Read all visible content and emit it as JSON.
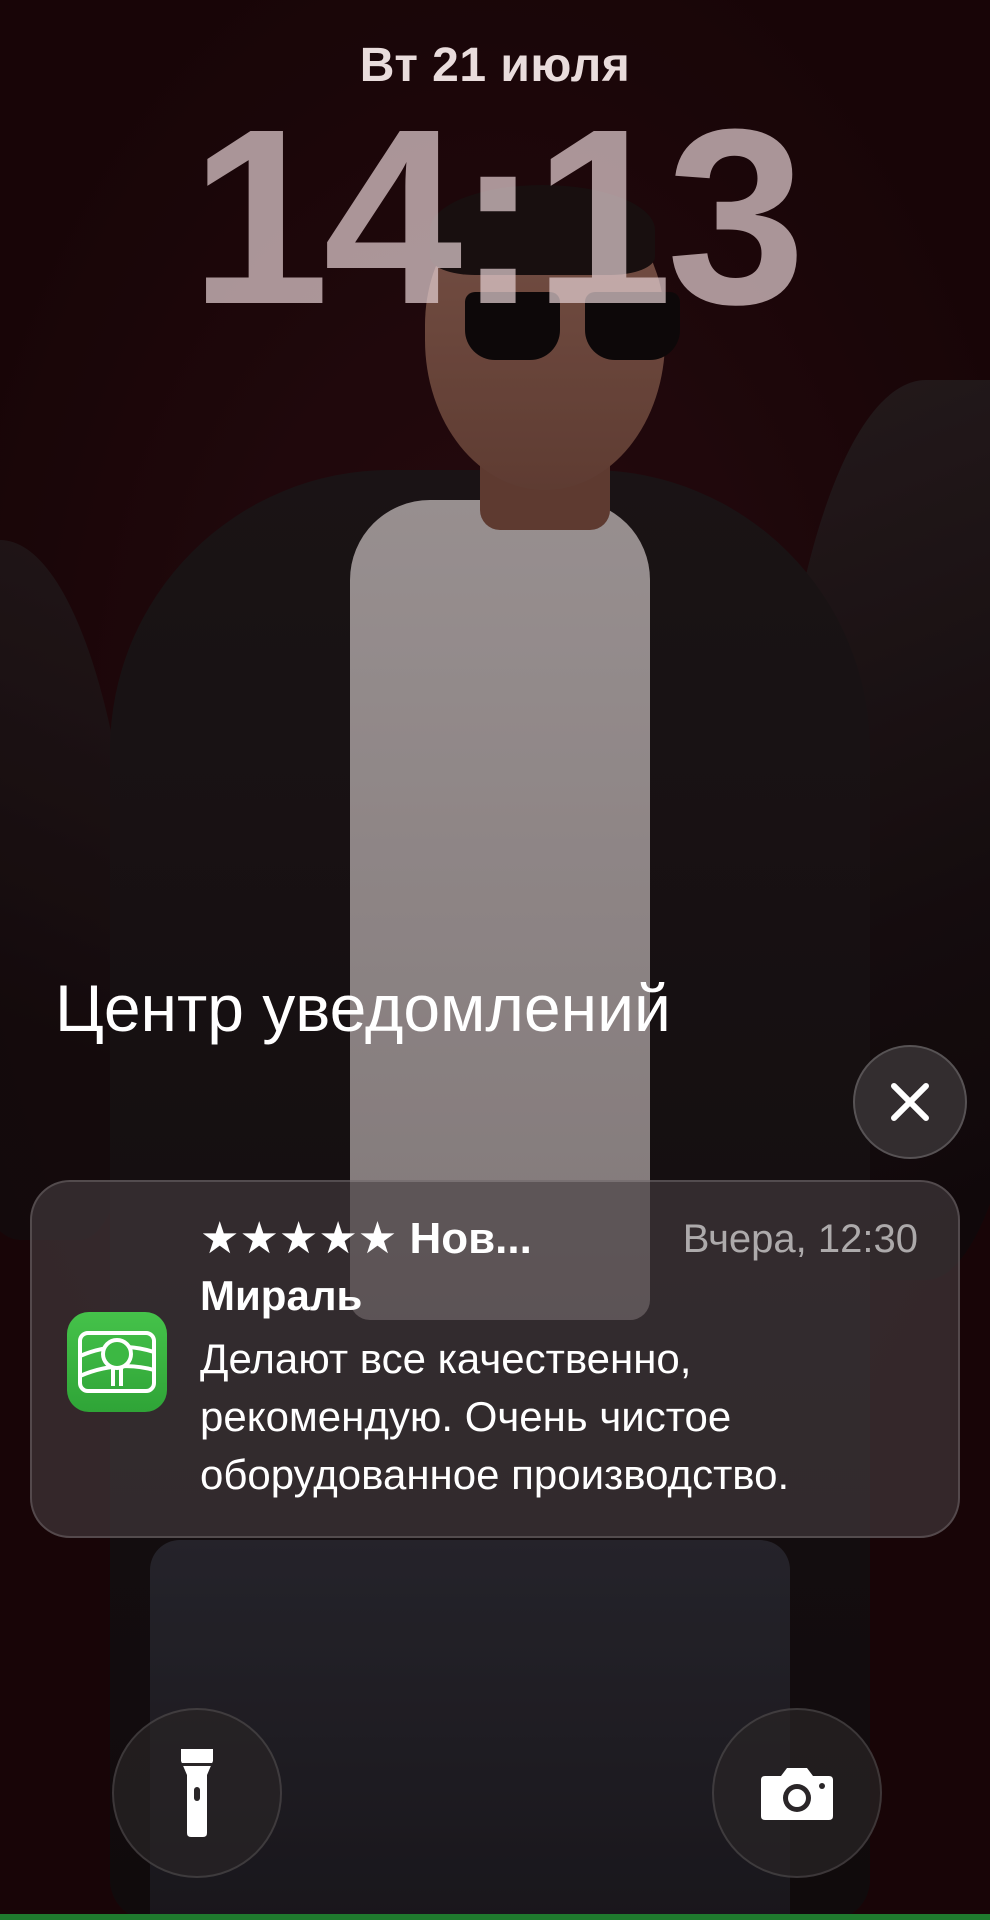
{
  "lockscreen": {
    "date": "Вт 21 июля",
    "time": "14:13"
  },
  "notification_center": {
    "title": "Центр уведомлений",
    "clear_icon": "close-icon"
  },
  "notification": {
    "app_icon": "miral-app-icon",
    "app_icon_color": "#3cb843",
    "stars": "★★★★★",
    "title_truncated": "Нов...",
    "timestamp": "Вчера, 12:30",
    "sender": "Мираль",
    "body_lines": [
      "Делают все качественно,",
      "рекомендую. Очень чистое",
      "оборудованное производство."
    ]
  },
  "quick_actions": {
    "flashlight_icon": "flashlight-icon",
    "camera_icon": "camera-icon"
  }
}
